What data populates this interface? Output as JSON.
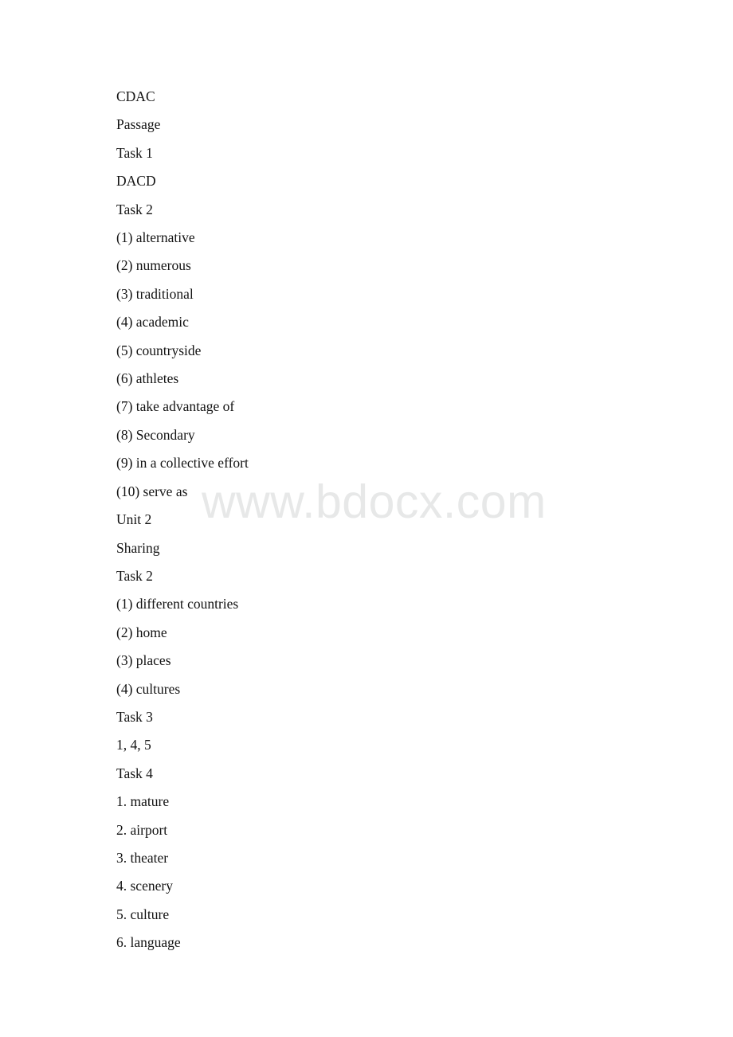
{
  "document": {
    "page_background": "#ffffff",
    "text_color": "#131313",
    "watermark": {
      "text": "www.bdocx.com",
      "color": "#e7e8e8"
    },
    "lines": [
      {
        "text": "CDAC"
      },
      {
        "text": "Passage"
      },
      {
        "text": "Task 1"
      },
      {
        "text": "DACD"
      },
      {
        "text": "Task 2"
      },
      {
        "text": "(1) alternative"
      },
      {
        "text": "(2) numerous"
      },
      {
        "text": "(3) traditional"
      },
      {
        "text": "(4) academic"
      },
      {
        "text": "(5) countryside"
      },
      {
        "text": "(6) athletes"
      },
      {
        "text": "(7) take advantage of"
      },
      {
        "text": "(8) Secondary"
      },
      {
        "text": "(9) in a collective effort"
      },
      {
        "text": "(10) serve as"
      },
      {
        "text": "Unit 2"
      },
      {
        "text": "Sharing"
      },
      {
        "text": "Task 2"
      },
      {
        "text": "(1) different countries"
      },
      {
        "text": "(2) home"
      },
      {
        "text": "(3) places"
      },
      {
        "text": "(4) cultures"
      },
      {
        "text": "Task 3"
      },
      {
        "text": "1, 4, 5"
      },
      {
        "text": "Task 4"
      },
      {
        "text": "1. mature"
      },
      {
        "text": "2. airport"
      },
      {
        "text": "3. theater"
      },
      {
        "text": "4. scenery"
      },
      {
        "text": "5. culture"
      },
      {
        "text": "6. language"
      }
    ]
  }
}
